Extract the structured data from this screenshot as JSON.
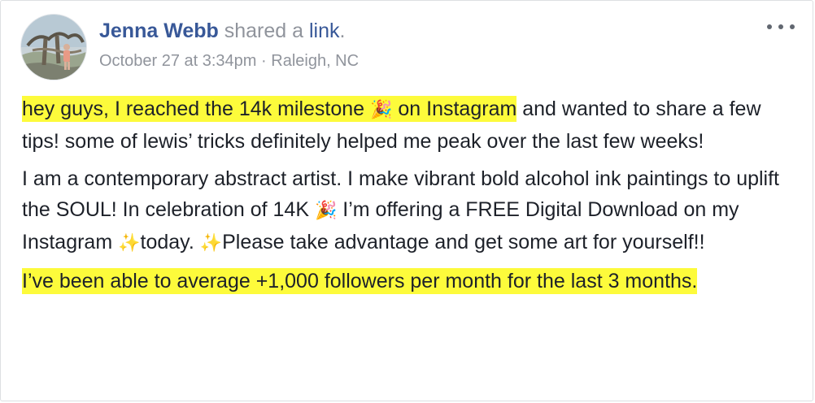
{
  "post": {
    "author": "Jenna Webb",
    "action_pre": "shared a",
    "action_link": "link",
    "action_post": ".",
    "timestamp": "October 27 at 3:34pm",
    "separator": "·",
    "location": "Raleigh, NC",
    "more_icon": "ellipsis-icon"
  },
  "content": {
    "p1_highlight_a": "hey guys, I reached the 14k milestone ",
    "p1_emoji_a": "🎉",
    "p1_highlight_b": " on Instagram",
    "p1_rest": " and wanted to share a few tips! some of lewis’ tricks definitely helped me peak over the last few weeks!",
    "p2_a": "I am a contemporary abstract artist. I make vibrant bold alcohol ink paintings to uplift the SOUL! In celebration of 14K ",
    "p2_emoji_a": "🎉",
    "p2_b": " I’m offering a FREE Digital Download on my Instagram ",
    "p2_emoji_b": "✨",
    "p2_c": "today. ",
    "p2_emoji_c": "✨",
    "p2_d": "Please take advantage and get some art for yourself!!",
    "p3_highlight": "I’ve been able to average +1,000 followers per month for the last 3 months."
  },
  "colors": {
    "highlight": "#fdfb3b",
    "link": "#385898",
    "meta": "#90949c",
    "text": "#1d2129"
  }
}
